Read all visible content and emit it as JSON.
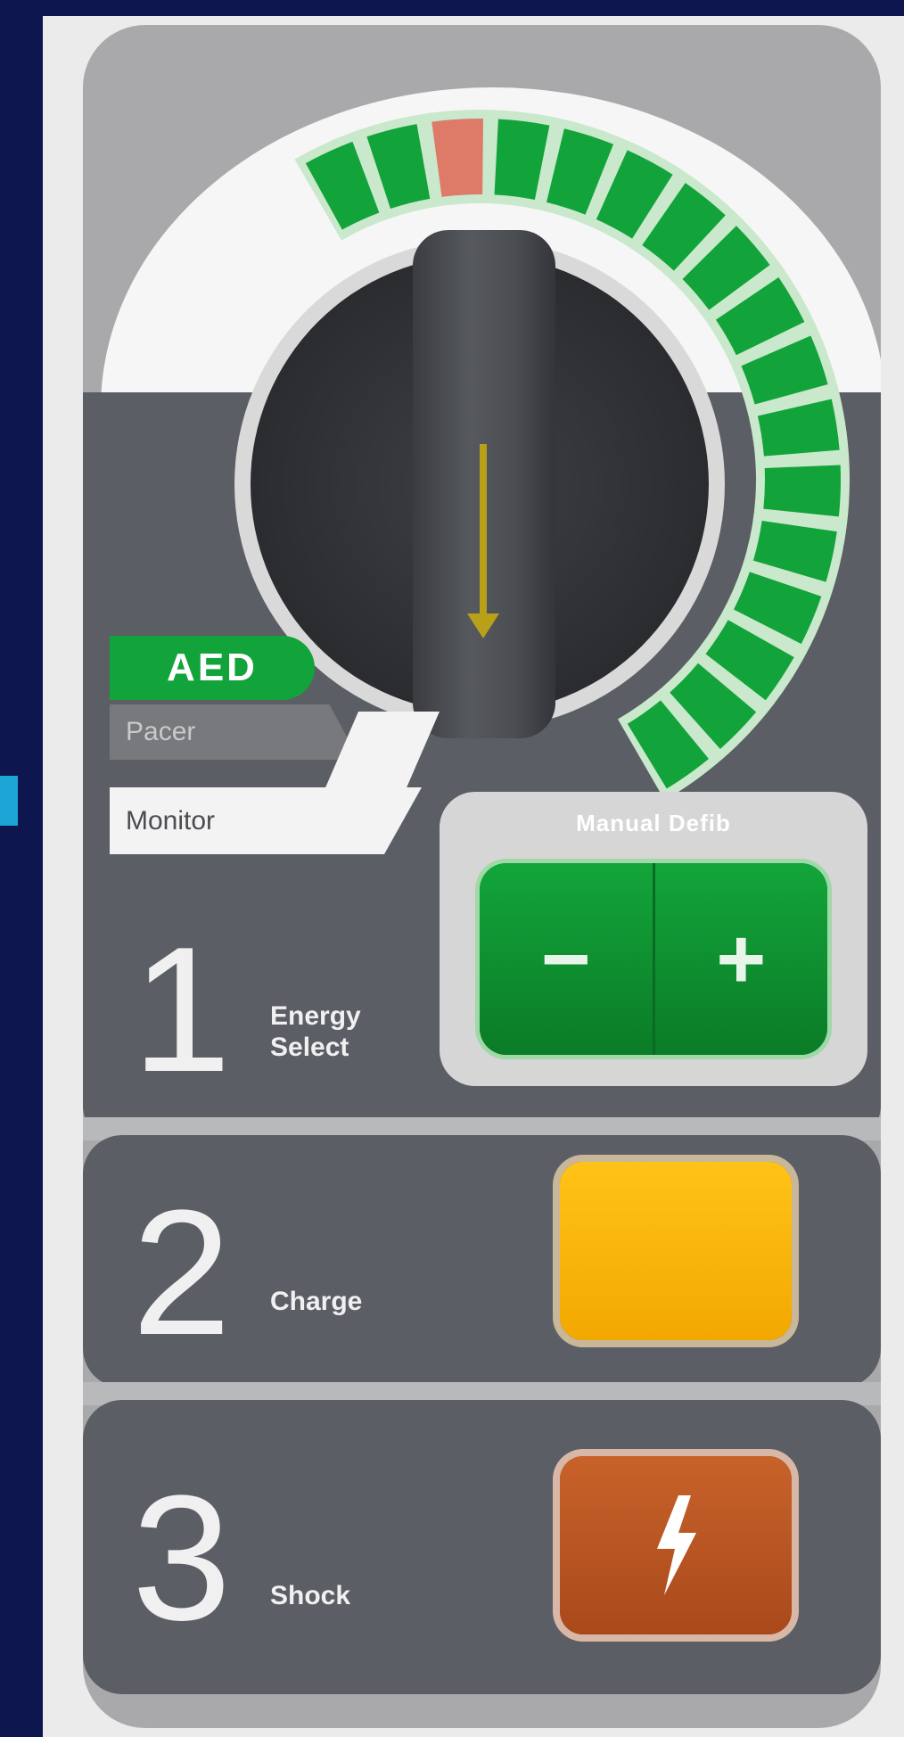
{
  "mode_selector": {
    "modes": [
      "AED",
      "Pacer",
      "Monitor"
    ],
    "active_mode": "AED",
    "energy_icons": [
      "energy-setting-icon"
    ],
    "colors": {
      "selected": "#dd7a68",
      "green": "#12a33a"
    }
  },
  "manual_defib": {
    "label": "Manual Defib",
    "minus": "−",
    "plus": "+"
  },
  "steps": [
    {
      "number": "1",
      "label_line1": "Energy",
      "label_line2": "Select"
    },
    {
      "number": "2",
      "label_line1": "Charge"
    },
    {
      "number": "3",
      "label_line1": "Shock"
    }
  ],
  "dial_stops": {
    "left": "",
    "right": ""
  },
  "colors": {
    "background": "#0e1650",
    "panel_gray": "#a9a9ab",
    "panel_dark": "#5b5e64",
    "charge_button": "#ffc317",
    "shock_button": "#c8622a"
  },
  "icons": {
    "shock": "lightning-bolt-icon",
    "knob": "rotary-knob-icon"
  }
}
